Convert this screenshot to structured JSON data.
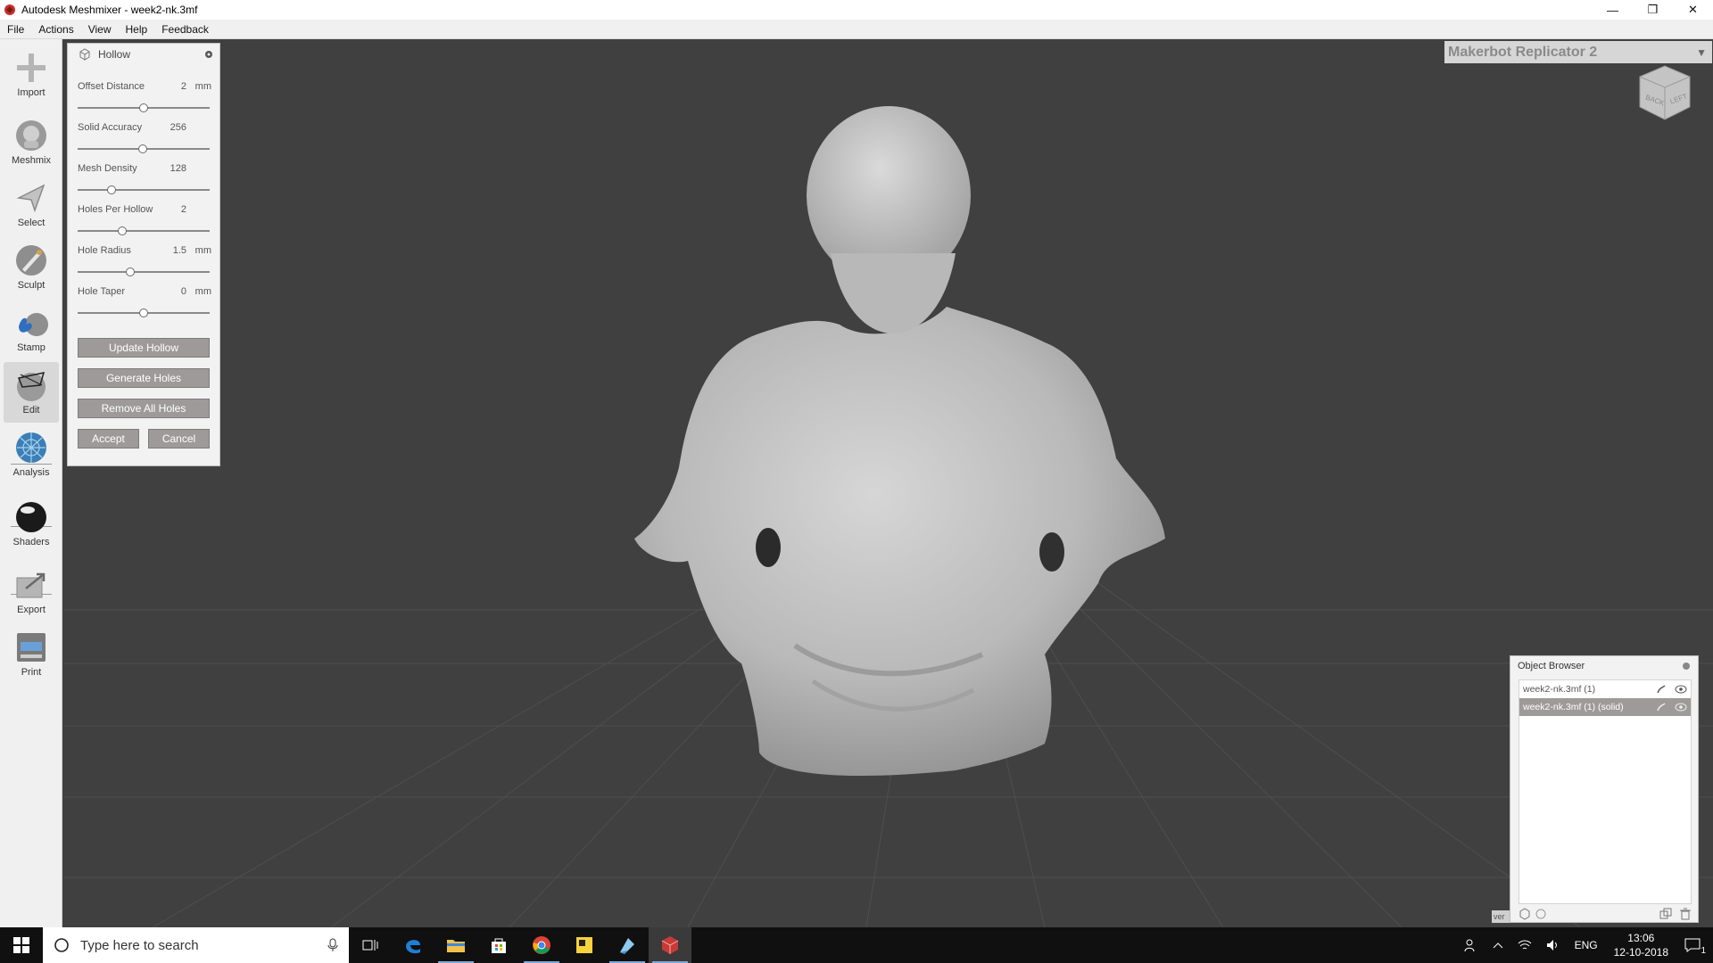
{
  "window": {
    "title": "Autodesk Meshmixer - week2-nk.3mf",
    "controls": {
      "minimize": "—",
      "restore": "❐",
      "close": "✕"
    }
  },
  "menu": [
    "File",
    "Actions",
    "View",
    "Help",
    "Feedback"
  ],
  "tools": [
    {
      "label": "Import",
      "icon": "plus-icon"
    },
    {
      "label": "Meshmix",
      "icon": "meshmix-bust-icon"
    },
    {
      "label": "Select",
      "icon": "arrow-cursor-icon"
    },
    {
      "label": "Sculpt",
      "icon": "brush-icon"
    },
    {
      "label": "Stamp",
      "icon": "stamp-icon"
    },
    {
      "label": "Edit",
      "icon": "edit-sphere-icon"
    },
    {
      "label": "Analysis",
      "icon": "analysis-sphere-icon"
    },
    {
      "label": "Shaders",
      "icon": "shader-ball-icon"
    },
    {
      "label": "Export",
      "icon": "export-icon"
    },
    {
      "label": "Print",
      "icon": "printer-icon"
    }
  ],
  "hollow_panel": {
    "title": "Hollow",
    "params": [
      {
        "label": "Offset Distance",
        "value": "2",
        "unit": "mm",
        "level": 0.5
      },
      {
        "label": "Solid Accuracy",
        "value": "256",
        "unit": "",
        "level": 0.49
      },
      {
        "label": "Mesh Density",
        "value": "128",
        "unit": "",
        "level": 0.26
      },
      {
        "label": "Holes Per Hollow",
        "value": "2",
        "unit": "",
        "level": 0.34
      },
      {
        "label": "Hole Radius",
        "value": "1.5",
        "unit": "mm",
        "level": 0.4
      },
      {
        "label": "Hole Taper",
        "value": "0",
        "unit": "mm",
        "level": 0.5
      }
    ],
    "buttons": {
      "update": "Update Hollow",
      "generate": "Generate Holes",
      "remove": "Remove All Holes",
      "accept": "Accept",
      "cancel": "Cancel"
    }
  },
  "printer": {
    "name": "Makerbot Replicator 2"
  },
  "view_cube": {
    "faces": [
      "BACK",
      "LEFT"
    ]
  },
  "object_browser": {
    "title": "Object Browser",
    "objects": [
      {
        "name": "week2-nk.3mf (1)",
        "selected": false
      },
      {
        "name": "week2-nk.3mf (1) (solid)",
        "selected": true
      }
    ],
    "overflow_text": "ver"
  },
  "taskbar": {
    "search_placeholder": "Type here to search",
    "language": "ENG",
    "time": "13:06",
    "date": "12-10-2018",
    "notification_count": "1"
  }
}
